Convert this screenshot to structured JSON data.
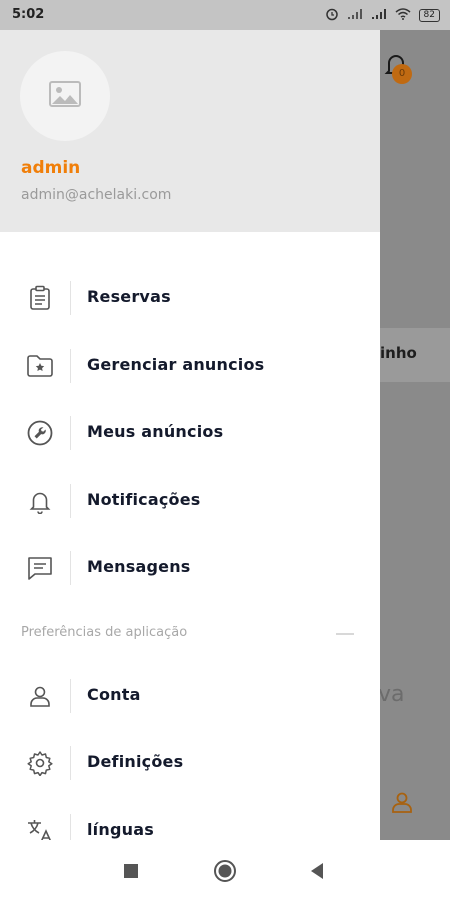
{
  "status_bar": {
    "time": "5:02",
    "battery": "82",
    "icons": [
      "alarm-icon",
      "signal-icon",
      "signal-icon",
      "wifi-icon",
      "battery-icon"
    ]
  },
  "background": {
    "notification_count": "0",
    "card_text": "inho",
    "faded_text": "va"
  },
  "drawer": {
    "user": {
      "name": "admin",
      "email": "admin@achelaki.com"
    },
    "items": [
      {
        "label": "Reservas",
        "icon": "clipboard-icon"
      },
      {
        "label": "Gerenciar anuncios",
        "icon": "folder-star-icon"
      },
      {
        "label": "Meus anúncios",
        "icon": "wrench-icon"
      },
      {
        "label": "Notificações",
        "icon": "bell-icon"
      },
      {
        "label": "Mensagens",
        "icon": "message-icon"
      }
    ],
    "section_title": "Preferências de aplicação",
    "pref_items": [
      {
        "label": "Conta",
        "icon": "user-icon"
      },
      {
        "label": "Definições",
        "icon": "gear-icon"
      },
      {
        "label": "línguas",
        "icon": "translate-icon"
      }
    ]
  },
  "nav_bar": {
    "icons": [
      "recents-icon",
      "home-icon",
      "back-icon"
    ]
  },
  "colors": {
    "accent": "#f07f0a",
    "text": "#141a2c",
    "muted": "#9a9a9a",
    "header_bg": "#e8e8e8"
  }
}
